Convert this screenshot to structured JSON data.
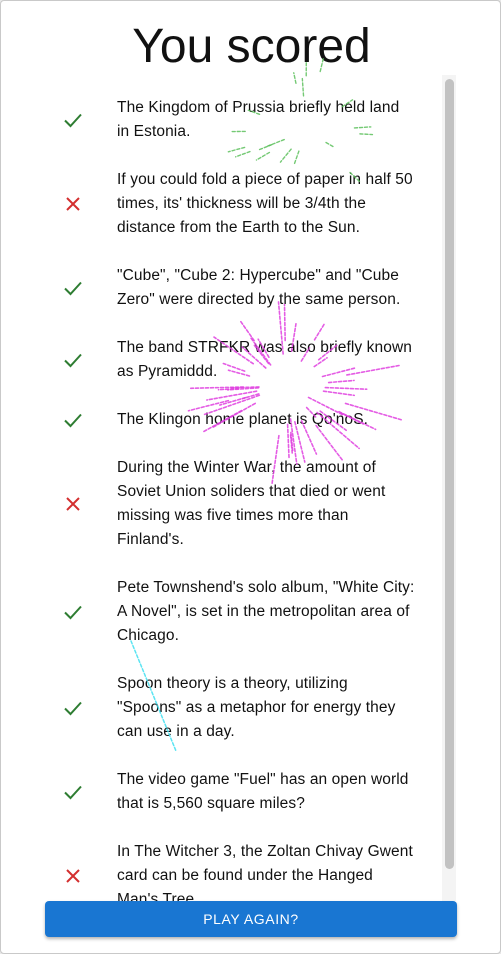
{
  "header": {
    "title": "You scored"
  },
  "results": [
    {
      "correct": true,
      "icon": "check-icon",
      "lines": [
        "The Kingdom of Prussia briefly held land",
        "in Estonia."
      ]
    },
    {
      "correct": false,
      "icon": "cross-icon",
      "lines": [
        "If you could fold a piece of paper in half 50",
        "times, its' thickness will be 3/4th the",
        "distance from the Earth to the Sun."
      ]
    },
    {
      "correct": true,
      "icon": "check-icon",
      "lines": [
        "\"Cube\", \"Cube 2: Hypercube\" and \"Cube",
        "Zero\" were directed by the same person."
      ]
    },
    {
      "correct": true,
      "icon": "check-icon",
      "lines": [
        "The band STRFKR was also briefly known",
        "as Pyramiddd."
      ]
    },
    {
      "correct": true,
      "icon": "check-icon",
      "lines": [
        "The Klingon home planet is Qo'noS."
      ]
    },
    {
      "correct": false,
      "icon": "cross-icon",
      "lines": [
        "During the Winter War, the amount of",
        "Soviet Union soliders that died or went",
        "missing was five times more than",
        "Finland's."
      ]
    },
    {
      "correct": true,
      "icon": "check-icon",
      "lines": [
        "Pete Townshend's solo album, \"White City:",
        "A Novel\", is set in the metropolitan area of",
        "Chicago."
      ]
    },
    {
      "correct": true,
      "icon": "check-icon",
      "lines": [
        "Spoon theory is a theory, utilizing",
        "\"Spoons\" as a metaphor for energy they",
        "can use in a day."
      ]
    },
    {
      "correct": true,
      "icon": "check-icon",
      "lines": [
        "The video game \"Fuel\" has an open world",
        "that is 5,560 square miles?"
      ]
    },
    {
      "correct": false,
      "icon": "cross-icon",
      "lines": [
        "In The Witcher 3, the Zoltan Chivay Gwent",
        "card can be found under the Hanged",
        "Man's Tree."
      ]
    }
  ],
  "actions": {
    "play_again_label": "PLAY AGAIN?"
  },
  "colors": {
    "correct": "#2e7d32",
    "incorrect": "#d32f2f",
    "button": "#1976d2",
    "firework_pink": "#e040e0",
    "firework_green": "#5cc05c",
    "firework_cyan": "#40e0f0"
  }
}
